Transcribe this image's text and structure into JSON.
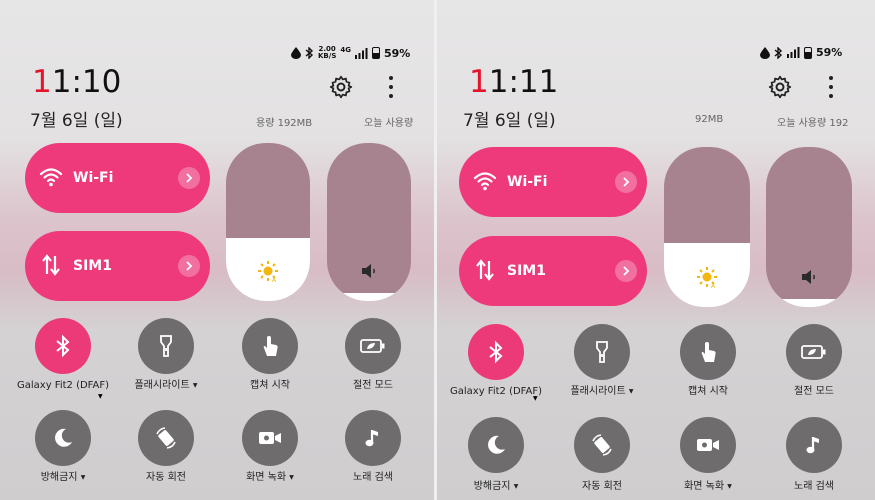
{
  "screens": [
    {
      "status": {
        "speed_value": "2.00",
        "speed_unit": "KB/S",
        "network": "4G",
        "battery": "59%"
      },
      "clock": {
        "hour_first": "1",
        "rest": "1:10"
      },
      "date": "7월 6일 (일)",
      "usage_left": "용량 192MB",
      "usage_right": "오늘 사용량",
      "wifi_label": "Wi-Fi",
      "sim_label": "SIM1",
      "brightness_level": 0.4,
      "volume_level": 0.05,
      "tiles": [
        {
          "label": "Galaxy Fit2 (DFAF)",
          "icon": "bluetooth-icon",
          "on": true,
          "dropdown": true
        },
        {
          "label": "플래시라이트",
          "icon": "flashlight-icon",
          "on": false,
          "dropdown": true
        },
        {
          "label": "캡쳐 시작",
          "icon": "touch-icon",
          "on": false,
          "dropdown": false
        },
        {
          "label": "절전 모드",
          "icon": "battery-saver-icon",
          "on": false,
          "dropdown": false
        },
        {
          "label": "방해금지",
          "icon": "moon-icon",
          "on": false,
          "dropdown": true
        },
        {
          "label": "자동 회전",
          "icon": "rotate-icon",
          "on": false,
          "dropdown": false
        },
        {
          "label": "화면 녹화",
          "icon": "screen-record-icon",
          "on": false,
          "dropdown": true
        },
        {
          "label": "노래 검색",
          "icon": "music-note-icon",
          "on": false,
          "dropdown": false
        }
      ]
    },
    {
      "status": {
        "battery": "59%"
      },
      "clock": {
        "hour_first": "1",
        "rest": "1:11"
      },
      "date": "7월 6일 (일)",
      "usage_left": "92MB",
      "usage_right": "오늘 사용량 192",
      "wifi_label": "Wi-Fi",
      "sim_label": "SIM1",
      "brightness_level": 0.4,
      "volume_level": 0.05,
      "tiles": [
        {
          "label": "Galaxy Fit2 (DFAF)",
          "icon": "bluetooth-icon",
          "on": true,
          "dropdown": true
        },
        {
          "label": "플래시라이트",
          "icon": "flashlight-icon",
          "on": false,
          "dropdown": true
        },
        {
          "label": "캡쳐 시작",
          "icon": "touch-icon",
          "on": false,
          "dropdown": false
        },
        {
          "label": "절전 모드",
          "icon": "battery-saver-icon",
          "on": false,
          "dropdown": false
        },
        {
          "label": "방해금지",
          "icon": "moon-icon",
          "on": false,
          "dropdown": true
        },
        {
          "label": "자동 회전",
          "icon": "rotate-icon",
          "on": false,
          "dropdown": false
        },
        {
          "label": "화면 녹화",
          "icon": "screen-record-icon",
          "on": false,
          "dropdown": true
        },
        {
          "label": "노래 검색",
          "icon": "music-note-icon",
          "on": false,
          "dropdown": false
        }
      ]
    }
  ],
  "colors": {
    "accent": "#ee3a7a",
    "tile_off": "#6e6c6d",
    "slider_bg": "#a6838f",
    "clock_red": "#e3142b"
  }
}
